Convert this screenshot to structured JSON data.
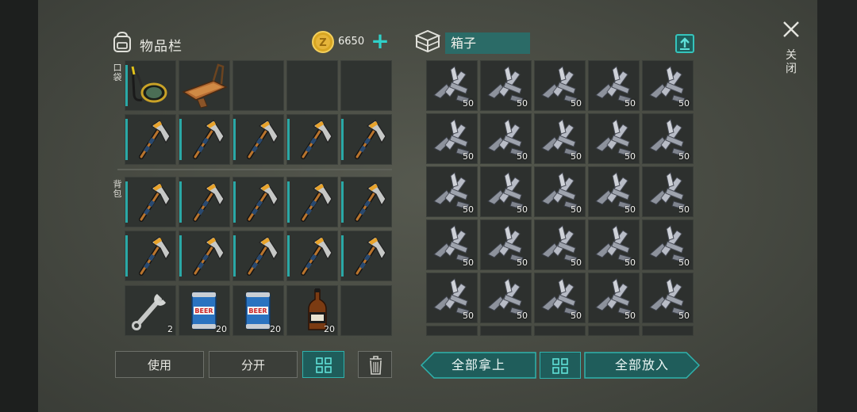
{
  "inventory": {
    "title": "物品栏",
    "coins": "6650",
    "pocket_label": "口袋",
    "backpack_label": "背包",
    "slots": [
      {
        "item": "diving-mask-icon",
        "qty": ""
      },
      {
        "item": "sluice-tray-icon",
        "qty": ""
      },
      {
        "item": "empty",
        "qty": ""
      },
      {
        "item": "empty",
        "qty": ""
      },
      {
        "item": "empty",
        "qty": ""
      },
      {
        "item": "hatchet-icon",
        "qty": ""
      },
      {
        "item": "hatchet-icon",
        "qty": ""
      },
      {
        "item": "hatchet-icon",
        "qty": ""
      },
      {
        "item": "hatchet-icon",
        "qty": ""
      },
      {
        "item": "hatchet-icon",
        "qty": ""
      },
      {
        "item": "hatchet-icon",
        "qty": ""
      },
      {
        "item": "hatchet-icon",
        "qty": ""
      },
      {
        "item": "hatchet-icon",
        "qty": ""
      },
      {
        "item": "hatchet-icon",
        "qty": ""
      },
      {
        "item": "hatchet-icon",
        "qty": ""
      },
      {
        "item": "hatchet-icon",
        "qty": ""
      },
      {
        "item": "hatchet-icon",
        "qty": ""
      },
      {
        "item": "hatchet-icon",
        "qty": ""
      },
      {
        "item": "hatchet-icon",
        "qty": ""
      },
      {
        "item": "hatchet-icon",
        "qty": ""
      },
      {
        "item": "wrench-icon",
        "qty": "2"
      },
      {
        "item": "beer-can-icon",
        "qty": "20"
      },
      {
        "item": "beer-can-icon",
        "qty": "20"
      },
      {
        "item": "whiskey-bottle-icon",
        "qty": "20"
      },
      {
        "item": "empty",
        "qty": ""
      }
    ],
    "buttons": {
      "use": "使用",
      "split": "分开"
    }
  },
  "container": {
    "title": "箱子",
    "item": "metal-scrap-icon",
    "qty": "50",
    "buttons": {
      "take_all": "全部拿上",
      "put_all": "全部放入"
    }
  },
  "close_label": "关闭",
  "colors": {
    "accent": "#2fb3ad",
    "slot_bg": "#2f3330",
    "panel_bg": "#474a42"
  }
}
